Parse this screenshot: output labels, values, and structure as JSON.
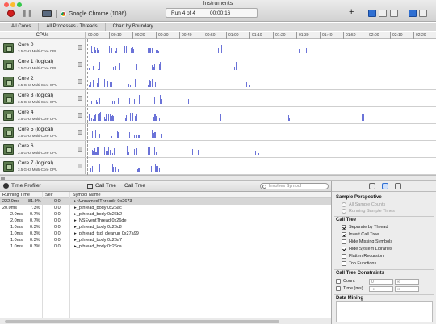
{
  "window": {
    "title": "Instruments",
    "traffic_colors": [
      "#fc5f57",
      "#fdbc2e",
      "#34c84a"
    ]
  },
  "toolbar": {
    "target_label": "Google Chrome (1086)",
    "run_label": "Run 4 of 4",
    "elapsed": "00:00:16",
    "add_symbol": "+"
  },
  "tabs": [
    "All Cores",
    "All Processes / Threads",
    "Chart by Boundary"
  ],
  "ruler": {
    "header": "CPUs",
    "ticks": [
      "00:00",
      "00:10",
      "00:20",
      "00:30",
      "00:40",
      "00:50",
      "01:00",
      "01:10",
      "01:20",
      "01:30",
      "01:40",
      "01:50",
      "02:00",
      "02:10",
      "02:20"
    ]
  },
  "cores": [
    {
      "name": "Core 0",
      "desc": "3.5 GHz Multi-Core CPU"
    },
    {
      "name": "Core 1 (logical)",
      "desc": "3.5 GHz Multi-Core CPU"
    },
    {
      "name": "Core 2",
      "desc": "3.5 GHz Multi-Core CPU"
    },
    {
      "name": "Core 3 (logical)",
      "desc": "3.5 GHz Multi-Core CPU"
    },
    {
      "name": "Core 4",
      "desc": "3.5 GHz Multi-Core CPU"
    },
    {
      "name": "Core 5 (logical)",
      "desc": "3.5 GHz Multi-Core CPU"
    },
    {
      "name": "Core 6",
      "desc": "3.5 GHz Multi-Core CPU"
    },
    {
      "name": "Core 7 (logical)",
      "desc": "3.5 GHz Multi-Core CPU"
    }
  ],
  "detail": {
    "instrument": "Time Profiler",
    "view_a": "Call Tree",
    "view_b": "Call Tree",
    "search_placeholder": "Involves Symbol",
    "columns": {
      "running_time": "Running Time",
      "self": "Self",
      "symbol": "Symbol Name"
    },
    "rows": [
      {
        "ms": "222.0ms",
        "pct": "81.9%",
        "self": "0.0",
        "symbol": "▸<Unnamed Thread> 0x2673"
      },
      {
        "ms": "20.0ms",
        "pct": "7.3%",
        "self": "0.0",
        "symbol": "▸_pthread_body 0x26ac"
      },
      {
        "ms": "2.0ms",
        "pct": "0.7%",
        "self": "0.0",
        "symbol": "▸_pthread_body 0x26b2"
      },
      {
        "ms": "2.0ms",
        "pct": "0.7%",
        "self": "0.0",
        "symbol": "▸_NSEventThread 0x26de"
      },
      {
        "ms": "1.0ms",
        "pct": "0.3%",
        "self": "0.0",
        "symbol": "▸_pthread_body 0x26c8"
      },
      {
        "ms": "1.0ms",
        "pct": "0.3%",
        "self": "0.0",
        "symbol": "▸_pthread_tsd_cleanup 0x27a99"
      },
      {
        "ms": "1.0ms",
        "pct": "0.3%",
        "self": "0.0",
        "symbol": "▸_pthread_body 0x26a7"
      },
      {
        "ms": "1.0ms",
        "pct": "0.3%",
        "self": "0.0",
        "symbol": "▸_pthread_body 0x26ca"
      }
    ]
  },
  "inspector": {
    "sample_perspective": {
      "title": "Sample Perspective",
      "options": [
        "All Sample Counts",
        "Running Sample Times"
      ]
    },
    "call_tree": {
      "title": "Call Tree",
      "options": [
        {
          "label": "Separate by Thread",
          "checked": true
        },
        {
          "label": "Invert Call Tree",
          "checked": true
        },
        {
          "label": "Hide Missing Symbols",
          "checked": false
        },
        {
          "label": "Hide System Libraries",
          "checked": true
        },
        {
          "label": "Flatten Recursion",
          "checked": false
        },
        {
          "label": "Top Functions",
          "checked": false
        }
      ]
    },
    "constraints": {
      "title": "Call Tree Constraints",
      "count_label": "Count",
      "time_label": "Time (ms)",
      "min_placeholder": "0",
      "max_placeholder": "∞",
      "time_min_placeholder": "-∞"
    },
    "data_mining": {
      "title": "Data Mining"
    }
  }
}
